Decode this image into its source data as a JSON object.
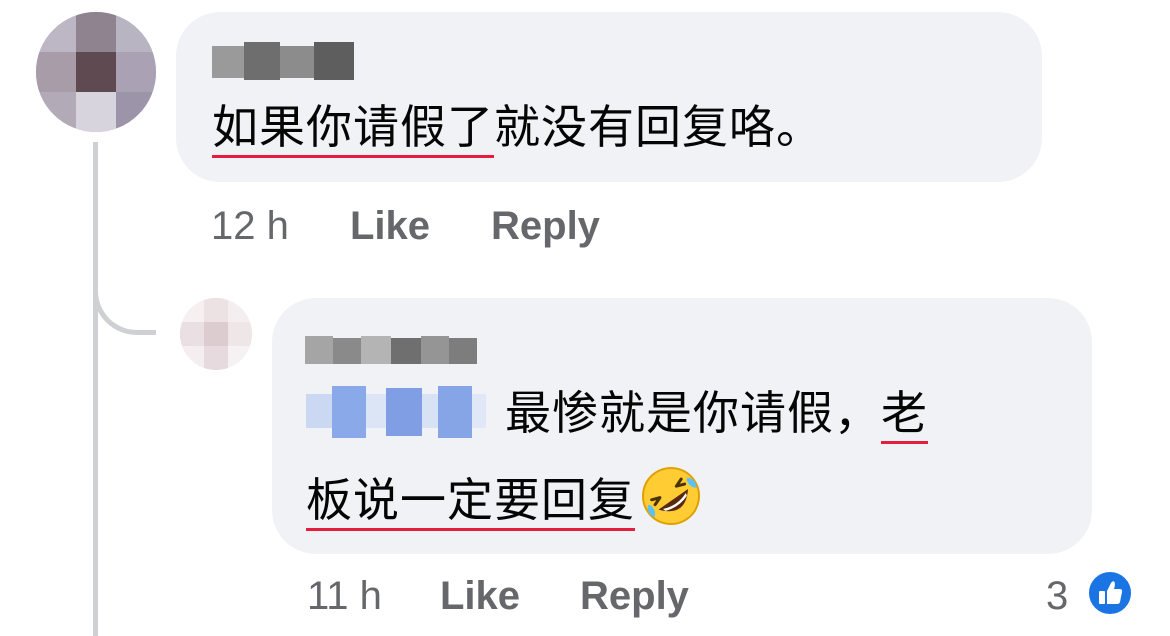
{
  "comment1": {
    "text_underlined": "如果你请假了",
    "text_rest": "就没有回复咯。",
    "time": "12 h",
    "like_label": "Like",
    "reply_label": "Reply"
  },
  "comment2": {
    "line1_text": "最惨就是你请假，",
    "line1_underlined": "老",
    "line2_underlined": "板说一定要回复",
    "emoji": "rolling-on-the-floor-laughing",
    "time": "11 h",
    "like_label": "Like",
    "reply_label": "Reply",
    "reaction_count": "3"
  },
  "colors": {
    "bubble": "#f0f2f5",
    "meta": "#65676b",
    "underline": "#e41e3f",
    "like_badge": "#1b74e4"
  }
}
